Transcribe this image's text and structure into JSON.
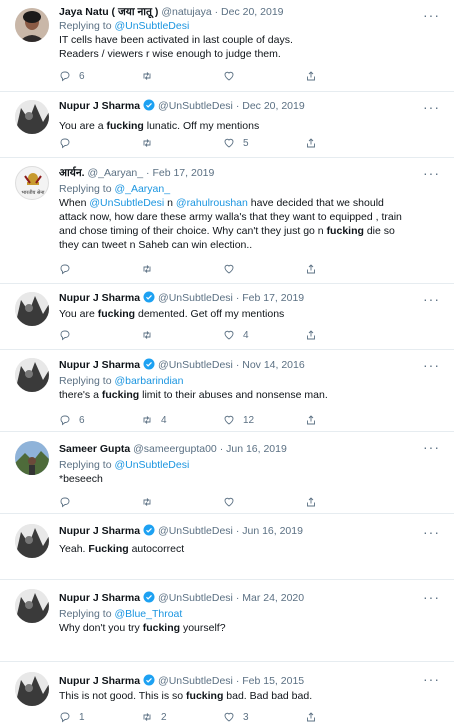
{
  "tweets": [
    {
      "name": "Jaya Natu ( जया नातू )",
      "handle": "@natujaya",
      "date": "Dec 20, 2019",
      "verified": false,
      "replying_label": "Replying to",
      "replying_to": "@UnSubtleDesi",
      "text_lines": [
        "IT cells have been activated in last couple of days.",
        "Readers / viewers r wise enough to judge them."
      ],
      "replies": "6",
      "retweets": "",
      "likes": "",
      "avatar_icon": "woman-photo-avatar"
    },
    {
      "name": "Nupur J Sharma",
      "handle": "@UnSubtleDesi",
      "date": "Dec 20, 2019",
      "verified": true,
      "text_pre": "You are a ",
      "text_bold": "fucking",
      "text_post": " lunatic. Off my mentions",
      "replies": "",
      "retweets": "",
      "likes": "5",
      "avatar_icon": "bw-photo-avatar"
    },
    {
      "name": "आर्यन.",
      "handle": "@_Aaryan_",
      "date": "Feb 17, 2019",
      "verified": false,
      "replying_label": "Replying to",
      "replying_to": "@_Aaryan_",
      "text_line1_pre": "When ",
      "text_line1_m1": "@UnSubtleDesi",
      "text_line1_mid": " n ",
      "text_line1_m2": "@rahulroushan",
      "text_line1_post": " have decided that we should",
      "text_line2": "attack now, how dare these army walla's that they want to equipped , train",
      "text_line3_pre": "and chose timing of their choice. Why can't they just go n ",
      "text_line3_bold": "fucking",
      "text_line3_post": " die so",
      "text_line4": "they can tweet n Saheb can win election..",
      "replies": "",
      "retweets": "",
      "likes": "",
      "avatar_icon": "army-emblem-avatar",
      "avatar_text": "भारतीय सेना"
    },
    {
      "name": "Nupur J Sharma",
      "handle": "@UnSubtleDesi",
      "date": "Feb 17, 2019",
      "verified": true,
      "text_pre": "You are ",
      "text_bold": "fucking",
      "text_post": " demented. Get off my mentions",
      "replies": "",
      "retweets": "",
      "likes": "4",
      "avatar_icon": "bw-photo-avatar"
    },
    {
      "name": "Nupur J Sharma",
      "handle": "@UnSubtleDesi",
      "date": "Nov 14, 2016",
      "verified": true,
      "replying_label": "Replying to",
      "replying_to": "@barbarindian",
      "text_pre": "there's a ",
      "text_bold": "fucking",
      "text_post": " limit to their abuses and nonsense man.",
      "replies": "6",
      "retweets": "4",
      "likes": "12",
      "avatar_icon": "bw-photo-avatar"
    },
    {
      "name": "Sameer Gupta",
      "handle": "@sameergupta00",
      "date": "Jun 16, 2019",
      "verified": false,
      "replying_label": "Replying to",
      "replying_to": "@UnSubtleDesi",
      "text": "*beseech",
      "replies": "",
      "retweets": "",
      "likes": "",
      "avatar_icon": "landscape-photo-avatar"
    },
    {
      "name": "Nupur J Sharma",
      "handle": "@UnSubtleDesi",
      "date": "Jun 16, 2019",
      "verified": true,
      "text_pre": "Yeah. ",
      "text_bold": "Fucking",
      "text_post": " autocorrect",
      "replies": "",
      "retweets": "",
      "likes": "",
      "avatar_icon": "bw-photo-avatar"
    },
    {
      "name": "Nupur J Sharma",
      "handle": "@UnSubtleDesi",
      "date": "Mar 24, 2020",
      "verified": true,
      "replying_label": "Replying to",
      "replying_to": "@Blue_Throat",
      "text_pre": "Why don't you try ",
      "text_bold": "fucking",
      "text_post": " yourself?",
      "replies": "",
      "retweets": "",
      "likes": "",
      "avatar_icon": "bw-photo-avatar"
    },
    {
      "name": "Nupur J Sharma",
      "handle": "@UnSubtleDesi",
      "date": "Feb 15, 2015",
      "verified": true,
      "text_pre": "This is not good. This is so ",
      "text_bold": "fucking",
      "text_post": " bad. Bad bad bad.",
      "replies": "1",
      "retweets": "2",
      "likes": "3",
      "avatar_icon": "bw-photo-avatar"
    }
  ],
  "dot": "·",
  "more_icon": "more-icon",
  "colors": {
    "link": "#1b95e0",
    "secondary": "#5b7083",
    "verified": "#1da1f2",
    "border": "#e6ecf0"
  }
}
